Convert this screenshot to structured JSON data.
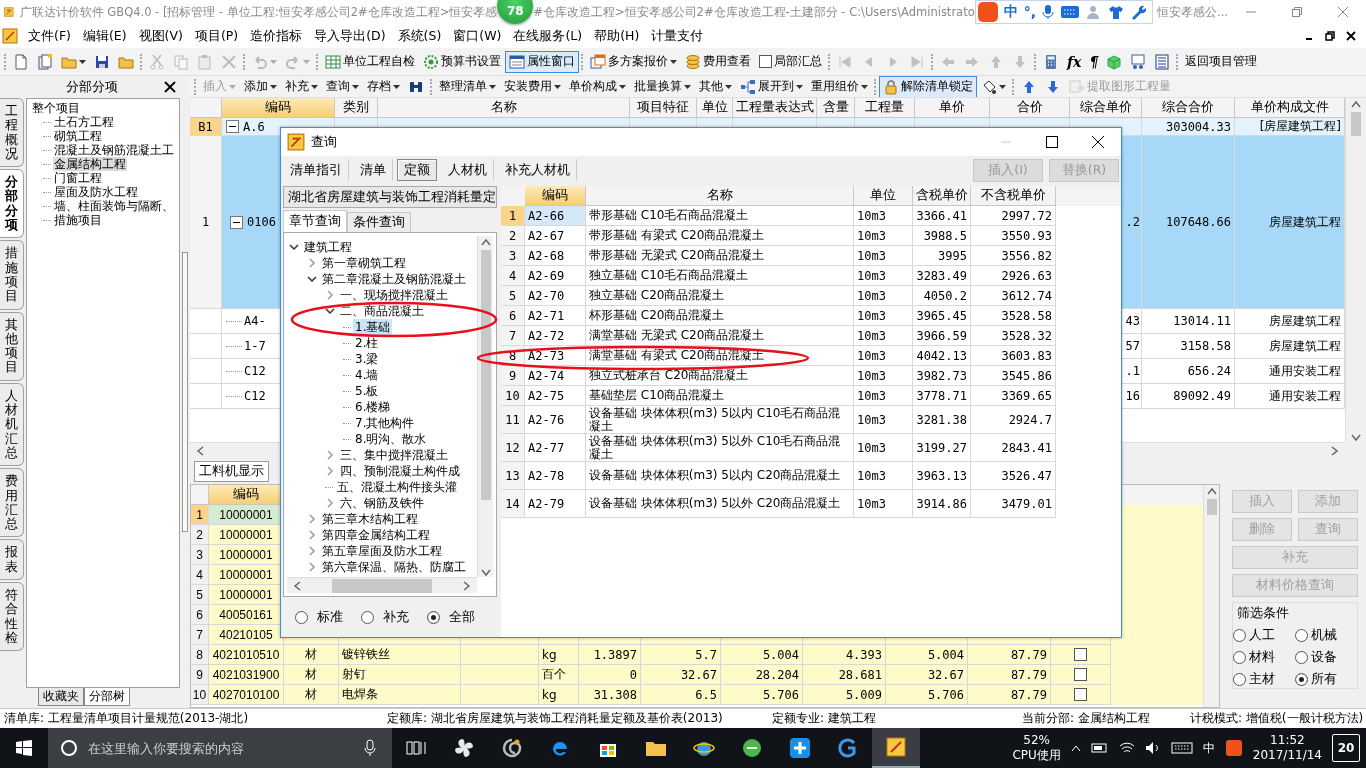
{
  "title_bar": {
    "title": "广联达计价软件 GBQ4.0 - [招标管理 - 单位工程:恒安孝感公司2#仓库改造工程>恒安孝感",
    "badge": "78",
    "title_continued": "#仓库改造工程>恒安孝感公司2#仓库改造工程-土建部分 - C:\\Users\\Administrato",
    "ime": {
      "mode": "中",
      "punctuation": "°,"
    },
    "title_tail": "恒安孝感公..."
  },
  "menu": [
    "文件(F)",
    "编辑(E)",
    "视图(V)",
    "项目(P)",
    "造价指标",
    "导入导出(D)",
    "系统(S)",
    "窗口(W)",
    "在线服务(L)",
    "帮助(H)",
    "计量支付"
  ],
  "toolbar_main": [
    {
      "kind": "icon",
      "disabled": false
    },
    {
      "kind": "icon",
      "disabled": false
    },
    {
      "kind": "icon_caret",
      "disabled": false
    },
    {
      "kind": "icon",
      "disabled": false
    },
    {
      "kind": "icon",
      "disabled": false
    },
    {
      "kind": "separator"
    },
    {
      "kind": "icon",
      "disabled": true
    },
    {
      "kind": "icon",
      "disabled": true
    },
    {
      "kind": "icon",
      "disabled": true
    },
    {
      "kind": "icon",
      "disabled": true
    },
    {
      "kind": "separator"
    },
    {
      "kind": "icon_caret",
      "disabled": true
    },
    {
      "kind": "icon_caret",
      "disabled": true
    },
    {
      "kind": "separator"
    },
    {
      "kind": "icon_button",
      "label": "单位工程自检",
      "pressed": false,
      "disabled": false
    },
    {
      "kind": "icon_button",
      "label": "预算书设置",
      "pressed": false,
      "disabled": false
    },
    {
      "kind": "icon_button",
      "label": "属性窗口",
      "pressed": true,
      "disabled": false
    },
    {
      "kind": "separator"
    },
    {
      "kind": "icon_dropdown",
      "label": "多方案报价",
      "disabled": false
    },
    {
      "kind": "icon_button",
      "label": "费用查看",
      "pressed": false,
      "disabled": false
    },
    {
      "kind": "checkbox",
      "label": "局部汇总",
      "checked": false
    },
    {
      "kind": "separator"
    },
    {
      "kind": "icon",
      "disabled": true
    },
    {
      "kind": "icon",
      "disabled": true
    },
    {
      "kind": "icon",
      "disabled": true
    },
    {
      "kind": "icon",
      "disabled": true
    },
    {
      "kind": "separator"
    },
    {
      "kind": "icon",
      "disabled": true
    },
    {
      "kind": "icon",
      "disabled": true
    },
    {
      "kind": "icon",
      "disabled": true
    },
    {
      "kind": "icon",
      "disabled": true
    },
    {
      "kind": "separator"
    },
    {
      "kind": "icon",
      "disabled": false
    },
    {
      "kind": "glyph",
      "text": "fx",
      "disabled": false
    },
    {
      "kind": "glyph",
      "text": "¶",
      "disabled": false
    },
    {
      "kind": "icon",
      "disabled": false
    },
    {
      "kind": "icon",
      "disabled": false
    },
    {
      "kind": "icon",
      "disabled": false
    },
    {
      "kind": "separator"
    },
    {
      "kind": "text_button",
      "label": "返回项目管理",
      "disabled": false
    }
  ],
  "side_tabs": [
    {
      "label": "工程概况",
      "selected": false
    },
    {
      "label": "分部分项",
      "selected": true
    },
    {
      "label": "措施项目",
      "selected": false
    },
    {
      "label": "其他项目",
      "selected": false
    },
    {
      "label": "人材机汇总",
      "selected": false
    },
    {
      "label": "费用汇总",
      "selected": false
    },
    {
      "label": "报表",
      "selected": false
    },
    {
      "label": "符合性检",
      "selected": false
    }
  ],
  "section_panel": {
    "title": "分部分项",
    "tree": [
      {
        "label": "整个项目",
        "selected": false,
        "children": [
          {
            "label": "土石方工程",
            "selected": false
          },
          {
            "label": "砌筑工程",
            "selected": false
          },
          {
            "label": "混凝土及钢筋混凝土工",
            "selected": false
          },
          {
            "label": "金属结构工程",
            "selected": true
          },
          {
            "label": "门窗工程",
            "selected": false
          },
          {
            "label": "屋面及防水工程",
            "selected": false
          },
          {
            "label": "墙、柱面装饰与隔断、",
            "selected": false
          },
          {
            "label": "措施项目",
            "selected": false
          }
        ]
      }
    ],
    "bottom_tabs": [
      {
        "label": "收藏夹",
        "selected": false
      },
      {
        "label": "分部树",
        "selected": true
      }
    ]
  },
  "toolbar_edit": [
    {
      "kind": "dropdown",
      "label": "插入",
      "disabled": true
    },
    {
      "kind": "dropdown",
      "label": "添加",
      "disabled": false
    },
    {
      "kind": "dropdown",
      "label": "补充",
      "disabled": false
    },
    {
      "kind": "dropdown",
      "label": "查询",
      "disabled": false
    },
    {
      "kind": "dropdown",
      "label": "存档",
      "disabled": false
    },
    {
      "kind": "icon",
      "disabled": false
    },
    {
      "kind": "separator"
    },
    {
      "kind": "dropdown",
      "label": "整理清单",
      "disabled": false
    },
    {
      "kind": "dropdown",
      "label": "安装费用",
      "disabled": false
    },
    {
      "kind": "dropdown",
      "label": "单价构成",
      "disabled": false
    },
    {
      "kind": "dropdown",
      "label": "批量换算",
      "disabled": false
    },
    {
      "kind": "dropdown",
      "label": "其他",
      "disabled": false
    },
    {
      "kind": "icon_dropdown",
      "label": "展开到",
      "disabled": false
    },
    {
      "kind": "dropdown",
      "label": "重用组价",
      "disabled": false
    },
    {
      "kind": "separator"
    },
    {
      "kind": "icon_button",
      "label": "解除清单锁定",
      "pressed": true,
      "disabled": false
    },
    {
      "kind": "icon_caret",
      "disabled": false
    },
    {
      "kind": "separator"
    },
    {
      "kind": "icon",
      "disabled": false
    },
    {
      "kind": "icon",
      "disabled": false
    },
    {
      "kind": "icon_button",
      "label": "提取图形工程量",
      "pressed": false,
      "disabled": true
    }
  ],
  "main_table": {
    "columns": [
      "编码",
      "类别",
      "名称",
      "项目特征",
      "单位",
      "工程量表达式",
      "含量",
      "工程量",
      "单价",
      "合价",
      "综合单价",
      "综合合价",
      "单价构成文件"
    ],
    "rows": [
      {
        "kind": "section",
        "header": "B1",
        "code": "A.6",
        "expanded": true,
        "current": true,
        "selected": false,
        "composite_total": "303004.33",
        "price_file": "[房屋建筑工程]"
      },
      {
        "kind": "item",
        "header": "1",
        "code": "0106",
        "expanded": true,
        "current": false,
        "selected": true,
        "composite_price": ".2",
        "composite_total": "107648.66",
        "price_file": "房屋建筑工程"
      },
      {
        "kind": "sub",
        "code": "A4-",
        "current": false,
        "selected": false,
        "composite_price": "43",
        "composite_total": "13014.11",
        "price_file": "房屋建筑工程"
      },
      {
        "kind": "sub",
        "code": "1-7",
        "current": false,
        "selected": false,
        "composite_price": "57",
        "composite_total": "3158.58",
        "price_file": "房屋建筑工程"
      },
      {
        "kind": "sub",
        "code": "C12",
        "current": false,
        "selected": false,
        "composite_price": ".1",
        "composite_total": "656.24",
        "price_file": "通用安装工程"
      },
      {
        "kind": "sub",
        "code": "C12",
        "current": false,
        "selected": false,
        "composite_price": "16",
        "composite_total": "89092.49",
        "price_file": "通用安装工程"
      }
    ]
  },
  "resource_panel": {
    "tabs": [
      {
        "label": "工料机显示",
        "selected": true
      }
    ],
    "columns": [
      "编码"
    ],
    "rows": [
      {
        "index": "1",
        "code": "10000001",
        "selected": true
      },
      {
        "index": "2",
        "code": "10000001",
        "selected": false
      },
      {
        "index": "3",
        "code": "10000001",
        "selected": false
      },
      {
        "index": "4",
        "code": "10000001",
        "selected": false
      },
      {
        "index": "5",
        "code": "10000001",
        "selected": false
      },
      {
        "index": "6",
        "code": "40050161",
        "selected": false
      },
      {
        "index": "7",
        "code": "40210105",
        "selected": false
      },
      {
        "index": "8",
        "code": "4021010510",
        "selected": false,
        "type": "材",
        "name": "镀锌铁丝",
        "unit": "kg",
        "quantity": "1.3897",
        "values": [
          "5.7",
          "5.004",
          "4.393",
          "5.004",
          "87.79"
        ],
        "checked": false
      },
      {
        "index": "9",
        "code": "4021031900",
        "selected": false,
        "type": "材",
        "name": "射钉",
        "unit": "百个",
        "quantity": "0",
        "values": [
          "32.67",
          "28.204",
          "28.681",
          "32.67",
          "87.79"
        ],
        "checked": false
      },
      {
        "index": "10",
        "code": "4027010100",
        "selected": false,
        "type": "材",
        "name": "电焊条",
        "unit": "kg",
        "quantity": "31.308",
        "values": [
          "6.5",
          "5.706",
          "5.009",
          "5.706",
          "87.79"
        ],
        "checked": false
      }
    ],
    "buttons": [
      {
        "label": "插入",
        "disabled": true
      },
      {
        "label": "添加",
        "disabled": true
      },
      {
        "label": "删除",
        "disabled": true
      },
      {
        "label": "查询",
        "disabled": true
      },
      {
        "label": "补充",
        "disabled": true
      },
      {
        "label": "材料价格查询",
        "disabled": true
      }
    ],
    "filter": {
      "title": "筛选条件",
      "options": [
        {
          "label": "人工",
          "selected": false
        },
        {
          "label": "机械",
          "selected": false
        },
        {
          "label": "材料",
          "selected": false
        },
        {
          "label": "设备",
          "selected": false
        },
        {
          "label": "主材",
          "selected": false
        },
        {
          "label": "所有",
          "selected": true
        }
      ]
    }
  },
  "dialog": {
    "title": "查询",
    "tabs": [
      {
        "label": "清单指引",
        "selected": false
      },
      {
        "label": "清单",
        "selected": false
      },
      {
        "label": "定额",
        "selected": true
      },
      {
        "label": "人材机",
        "selected": false
      },
      {
        "label": "补充人材机",
        "selected": false
      }
    ],
    "actions": [
      {
        "label": "插入(I)",
        "disabled": true
      },
      {
        "label": "替换(R)",
        "disabled": true
      }
    ],
    "library": "湖北省房屋建筑与装饰工程消耗量定",
    "search_tabs": [
      {
        "label": "章节查询",
        "selected": true
      },
      {
        "label": "条件查询",
        "selected": false
      }
    ],
    "tree": [
      {
        "label": "建筑工程",
        "expanded": true,
        "selected": false,
        "children": [
          {
            "label": "第一章砌筑工程",
            "expanded": false,
            "selected": false
          },
          {
            "label": "第二章混凝土及钢筋混凝土",
            "expanded": true,
            "selected": false,
            "children": [
              {
                "label": "一、现场搅拌混凝土",
                "expanded": false,
                "selected": false
              },
              {
                "label": "二、商品混凝土",
                "expanded": true,
                "selected": false,
                "children": [
                  {
                    "label": "1.基础",
                    "selected": true
                  },
                  {
                    "label": "2.柱",
                    "selected": false
                  },
                  {
                    "label": "3.梁",
                    "selected": false
                  },
                  {
                    "label": "4.墙",
                    "selected": false
                  },
                  {
                    "label": "5.板",
                    "selected": false
                  },
                  {
                    "label": "6.楼梯",
                    "selected": false
                  },
                  {
                    "label": "7.其他构件",
                    "selected": false
                  },
                  {
                    "label": "8.明沟、散水",
                    "selected": false
                  }
                ]
              },
              {
                "label": "三、集中搅拌混凝土",
                "expanded": false,
                "selected": false
              },
              {
                "label": "四、预制混凝土构件成",
                "expanded": false,
                "selected": false
              },
              {
                "label": "五、混凝土构件接头灌",
                "selected": false
              },
              {
                "label": "六、钢筋及铁件",
                "expanded": false,
                "selected": false
              }
            ]
          },
          {
            "label": "第三章木结构工程",
            "expanded": false,
            "selected": false
          },
          {
            "label": "第四章金属结构工程",
            "expanded": false,
            "selected": false
          },
          {
            "label": "第五章屋面及防水工程",
            "expanded": false,
            "selected": false
          },
          {
            "label": "第六章保温、隔热、防腐工",
            "expanded": false,
            "selected": false
          }
        ]
      }
    ],
    "filters": [
      {
        "label": "标准",
        "selected": false
      },
      {
        "label": "补充",
        "selected": false
      },
      {
        "label": "全部",
        "selected": true
      }
    ],
    "table": {
      "columns": [
        "编码",
        "名称",
        "单位",
        "含税单价",
        "不含税单价"
      ],
      "rows": [
        {
          "index": "1",
          "code": "A2-66",
          "name": "带形基础 C10毛石商品混凝土",
          "unit": "10m3",
          "tax_price": "3366.41",
          "net_price": "2997.72",
          "selected": true
        },
        {
          "index": "2",
          "code": "A2-67",
          "name": "带形基础 有梁式 C20商品混凝土",
          "unit": "10m3",
          "tax_price": "3988.5",
          "net_price": "3550.93",
          "selected": false
        },
        {
          "index": "3",
          "code": "A2-68",
          "name": "带形基础 无梁式 C20商品混凝土",
          "unit": "10m3",
          "tax_price": "3995",
          "net_price": "3556.82",
          "selected": false
        },
        {
          "index": "4",
          "code": "A2-69",
          "name": "独立基础 C10毛石商品混凝土",
          "unit": "10m3",
          "tax_price": "3283.49",
          "net_price": "2926.63",
          "selected": false
        },
        {
          "index": "5",
          "code": "A2-70",
          "name": "独立基础 C20商品混凝土",
          "unit": "10m3",
          "tax_price": "4050.2",
          "net_price": "3612.74",
          "selected": false
        },
        {
          "index": "6",
          "code": "A2-71",
          "name": "杯形基础 C20商品混凝土",
          "unit": "10m3",
          "tax_price": "3965.45",
          "net_price": "3528.58",
          "selected": false
        },
        {
          "index": "7",
          "code": "A2-72",
          "name": "满堂基础 无梁式 C20商品混凝土",
          "unit": "10m3",
          "tax_price": "3966.59",
          "net_price": "3528.32",
          "selected": false
        },
        {
          "index": "8",
          "code": "A2-73",
          "name": "满堂基础 有梁式 C20商品混凝土",
          "unit": "10m3",
          "tax_price": "4042.13",
          "net_price": "3603.83",
          "selected": false
        },
        {
          "index": "9",
          "code": "A2-74",
          "name": "独立式桩承台 C20商品混凝土",
          "unit": "10m3",
          "tax_price": "3982.73",
          "net_price": "3545.86",
          "selected": false
        },
        {
          "index": "10",
          "code": "A2-75",
          "name": "基础垫层 C10商品混凝土",
          "unit": "10m3",
          "tax_price": "3778.71",
          "net_price": "3369.65",
          "selected": false
        },
        {
          "index": "11",
          "code": "A2-76",
          "name": "设备基础 块体体积(m3) 5以内 C10毛石商品混凝土",
          "unit": "10m3",
          "tax_price": "3281.38",
          "net_price": "2924.7",
          "selected": false
        },
        {
          "index": "12",
          "code": "A2-77",
          "name": "设备基础 块体体积(m3) 5以外 C10毛石商品混凝土",
          "unit": "10m3",
          "tax_price": "3199.27",
          "net_price": "2843.41",
          "selected": false
        },
        {
          "index": "13",
          "code": "A2-78",
          "name": "设备基础 块体体积(m3) 5以内 C20商品混凝土",
          "unit": "10m3",
          "tax_price": "3963.13",
          "net_price": "3526.47",
          "selected": false
        },
        {
          "index": "14",
          "code": "A2-79",
          "name": "设备基础 块体体积(m3) 5以外 C20商品混凝土",
          "unit": "10m3",
          "tax_price": "3914.86",
          "net_price": "3479.01",
          "selected": false
        }
      ]
    }
  },
  "annotation_marks": [
    {
      "kind": "ellipse"
    },
    {
      "kind": "ellipse"
    }
  ],
  "status_bar": [
    "清单库: 工程量清单项目计量规范(2013-湖北)",
    "定额库: 湖北省房屋建筑与装饰工程消耗量定额及基价表(2013)",
    "定额专业: 建筑工程",
    "当前分部: 金属结构工程",
    "计税模式: 增值税(一般计税方法)"
  ],
  "taskbar": {
    "search_placeholder": "在这里输入你要搜索的内容",
    "cpu_value": "52%",
    "cpu_label": "CPU使用",
    "ime": "中",
    "time": "11:52",
    "date": "2017/11/14",
    "notifications": "20"
  }
}
